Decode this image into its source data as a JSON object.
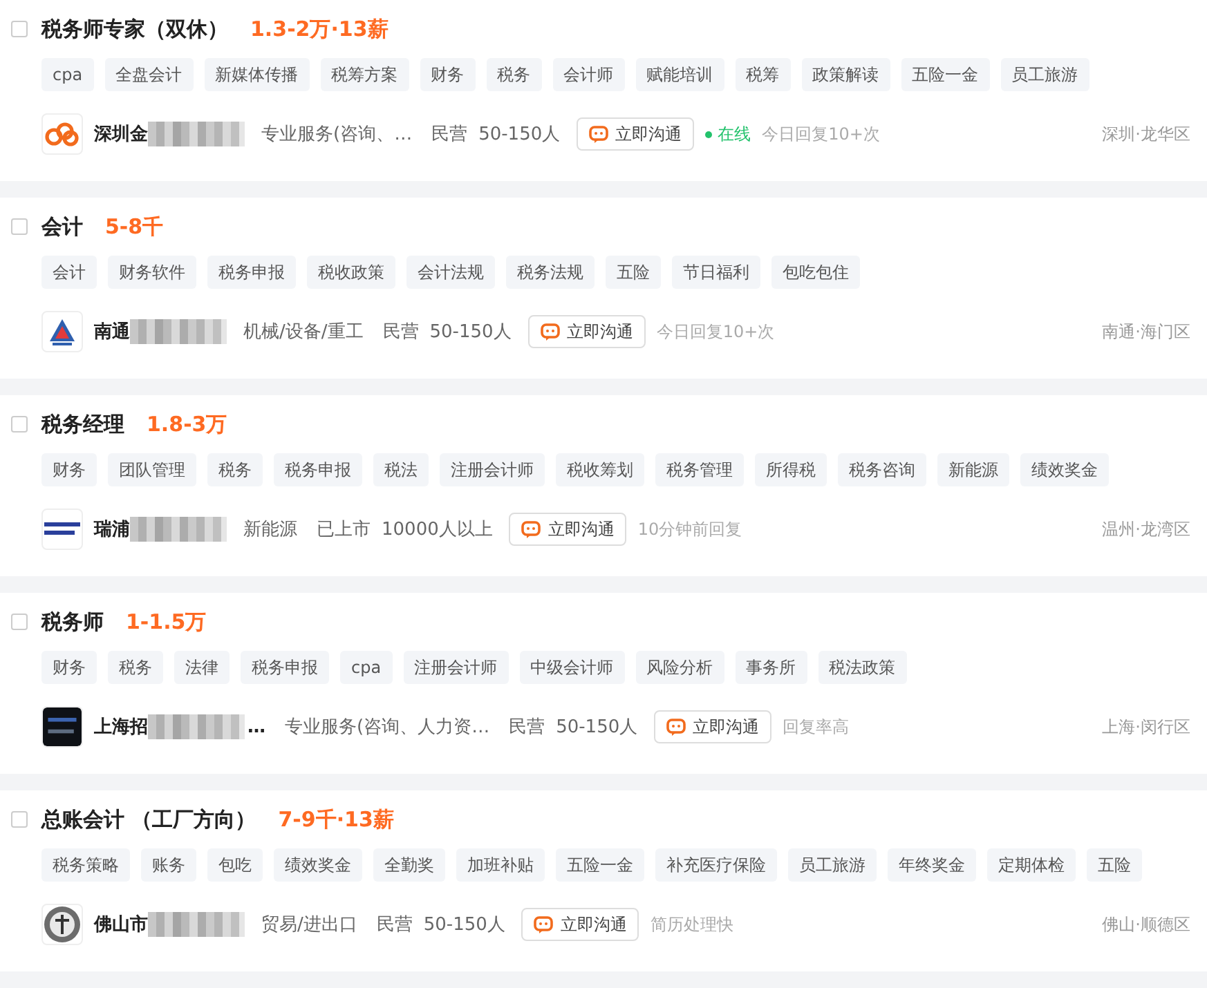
{
  "jobs": [
    {
      "selected": false,
      "title": "税务师专家（双休）",
      "salary": "1.3-2万·13薪",
      "tags": [
        "cpa",
        "全盘会计",
        "新媒体传播",
        "税筹方案",
        "财务",
        "税务",
        "会计师",
        "赋能培训",
        "税筹",
        "政策解读",
        "五险一金",
        "员工旅游"
      ],
      "company": {
        "logo": {
          "kind": "cloud"
        },
        "name": "深圳金",
        "industry": "专业服务(咨询、…",
        "type": "民营",
        "size": "50-150人"
      },
      "chat": "立即沟通",
      "online": true,
      "online_text": "在线",
      "reply": "今日回复10+次",
      "location": "深圳·龙华区"
    },
    {
      "selected": false,
      "title": "会计",
      "salary": "5-8千",
      "tags": [
        "会计",
        "财务软件",
        "税务申报",
        "税收政策",
        "会计法规",
        "税务法规",
        "五险",
        "节日福利",
        "包吃包住"
      ],
      "company": {
        "logo": {
          "kind": "triangle"
        },
        "name": "南通",
        "industry": "机械/设备/重工",
        "type": "民营",
        "size": "50-150人"
      },
      "chat": "立即沟通",
      "online": false,
      "reply": "今日回复10+次",
      "location": "南通·海门区"
    },
    {
      "selected": false,
      "title": "税务经理",
      "salary": "1.8-3万",
      "tags": [
        "财务",
        "团队管理",
        "税务",
        "税务申报",
        "税法",
        "注册会计师",
        "税收筹划",
        "税务管理",
        "所得税",
        "税务咨询",
        "新能源",
        "绩效奖金"
      ],
      "company": {
        "logo": {
          "kind": "wordmark"
        },
        "name": "瑞浦",
        "industry": "新能源",
        "type": "已上市",
        "size": "10000人以上"
      },
      "chat": "立即沟通",
      "online": false,
      "reply": "10分钟前回复",
      "location": "温州·龙湾区"
    },
    {
      "selected": false,
      "title": "税务师",
      "salary": "1-1.5万",
      "tags": [
        "财务",
        "税务",
        "法律",
        "税务申报",
        "cpa",
        "注册会计师",
        "中级会计师",
        "风险分析",
        "事务所",
        "税法政策"
      ],
      "company": {
        "logo": {
          "kind": "dark"
        },
        "name": "上海招",
        "name_tail": "…",
        "industry": "专业服务(咨询、人力资…",
        "type": "民营",
        "size": "50-150人"
      },
      "chat": "立即沟通",
      "online": false,
      "reply": "回复率高",
      "location": "上海·闵行区"
    },
    {
      "selected": false,
      "title": "总账会计 （工厂方向）",
      "salary": "7-9千·13薪",
      "tags": [
        "税务策略",
        "账务",
        "包吃",
        "绩效奖金",
        "全勤奖",
        "加班补贴",
        "五险一金",
        "补充医疗保险",
        "员工旅游",
        "年终奖金",
        "定期体检",
        "五险"
      ],
      "company": {
        "logo": {
          "kind": "seal"
        },
        "name": "佛山市",
        "industry": "贸易/进出口",
        "type": "民营",
        "size": "50-150人"
      },
      "chat": "立即沟通",
      "online": false,
      "reply": "简历处理快",
      "location": "佛山·顺德区"
    }
  ]
}
